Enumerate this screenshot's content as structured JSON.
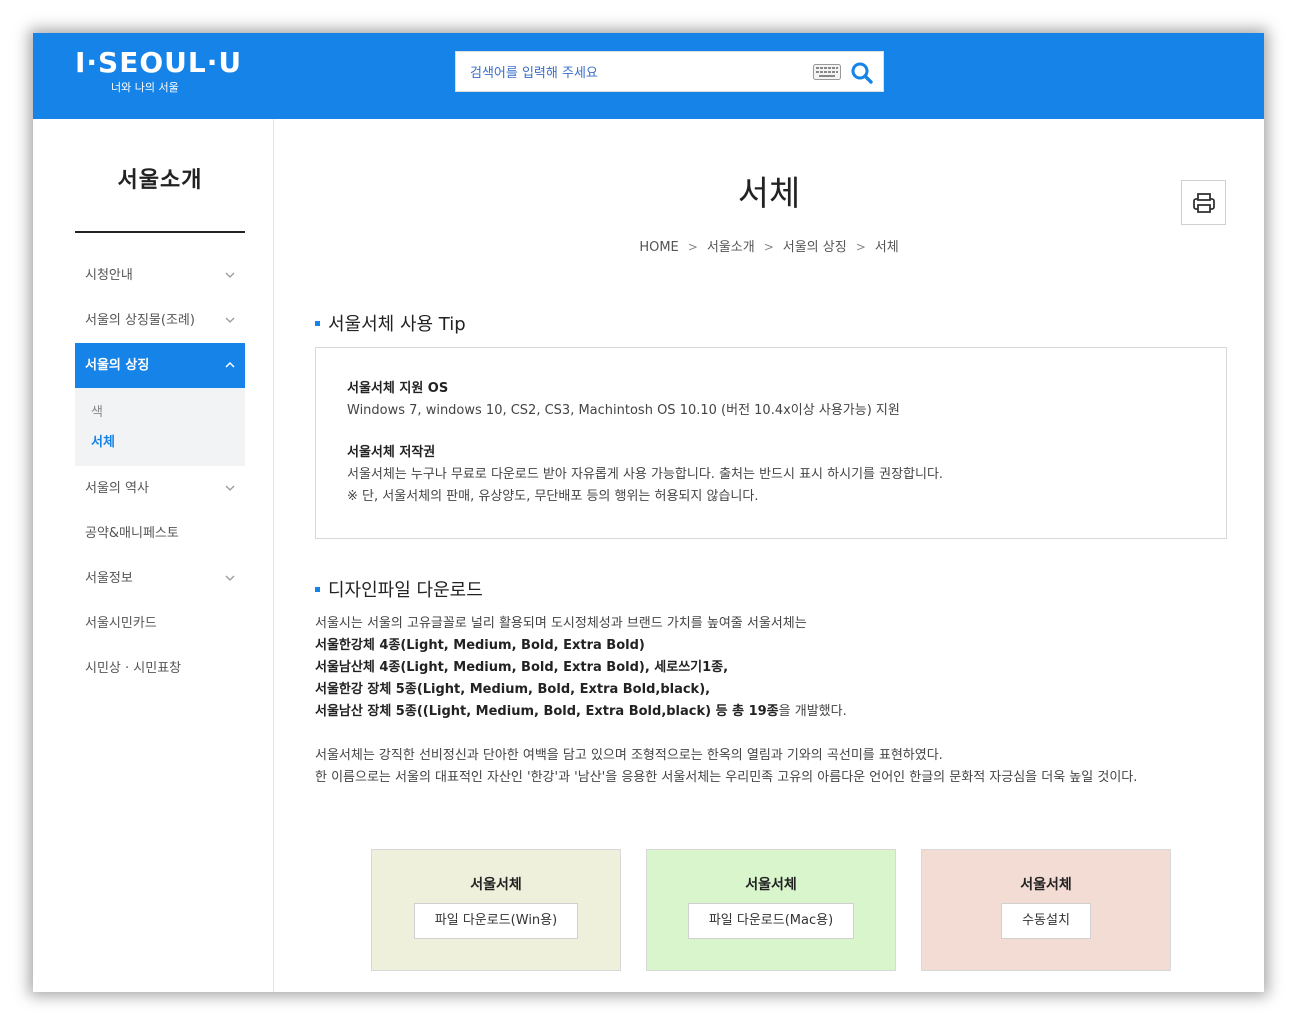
{
  "header": {
    "logo_text": "I·SEOUL·U",
    "logo_sub": "너와 나의 서울",
    "search_placeholder": "검색어를 입력해 주세요"
  },
  "sidebar": {
    "title": "서울소개",
    "items": [
      {
        "label": "시청안내",
        "has_chevron": true
      },
      {
        "label": "서울의 상징물(조례)",
        "has_chevron": true
      },
      {
        "label": "서울의 상징",
        "has_chevron": true,
        "active": true
      },
      {
        "label": "서울의 역사",
        "has_chevron": true
      },
      {
        "label": "공약&매니페스토",
        "has_chevron": false
      },
      {
        "label": "서울정보",
        "has_chevron": true
      },
      {
        "label": "서울시민카드",
        "has_chevron": false
      },
      {
        "label": "시민상 · 시민표창",
        "has_chevron": false
      }
    ],
    "subitems": [
      {
        "label": "색",
        "selected": false
      },
      {
        "label": "서체",
        "selected": true
      }
    ]
  },
  "main": {
    "page_title": "서체",
    "breadcrumb": [
      "HOME",
      "서울소개",
      "서울의 상징",
      "서체"
    ],
    "section1_title": "서울서체 사용 Tip",
    "tip": {
      "os_heading": "서울서체 지원 OS",
      "os_text": "Windows 7, windows 10, CS2, CS3, Machintosh OS 10.10 (버전 10.4x이상 사용가능) 지원",
      "copyright_heading": "서울서체 저작권",
      "copyright_text1": "서울서체는 누구나 무료로 다운로드 받아 자유롭게 사용 가능합니다. 출처는 반드시 표시 하시기를 권장합니다.",
      "copyright_text2": "※ 단, 서울서체의 판매, 유상양도, 무단배포 등의 행위는 허용되지 않습니다."
    },
    "section2_title": "디자인파일 다운로드",
    "intro": "서울시는 서울의 고유글꼴로 널리 활용되며 도시정체성과 브랜드 가치를 높여줄 서울서체는",
    "font_lines": [
      "서울한강체 4종(Light, Medium, Bold, Extra Bold)",
      "서울남산체 4종(Light, Medium, Bold, Extra Bold), 세로쓰기1종,",
      "서울한강 장체 5종(Light, Medium, Bold, Extra Bold,black),",
      "서울남산 장체 5종((Light, Medium, Bold, Extra Bold,black) 등 총 19종"
    ],
    "font_lines_tail": "을 개발했다.",
    "desc1": "서울서체는 강직한 선비정신과 단아한 여백을 담고 있으며 조형적으로는 한옥의 열림과 기와의 곡선미를 표현하였다.",
    "desc2": "한 이름으로는 서울의 대표적인 자산인 '한강'과 '남산'을 응용한 서울서체는 우리민족 고유의 아름다운 언어인 한글의 문화적 자긍심을 더욱 높일 것이다.",
    "downloads": [
      {
        "label": "서울서체",
        "button": "파일 다운로드(Win용)",
        "bg": "#eef0dc"
      },
      {
        "label": "서울서체",
        "button": "파일 다운로드(Mac용)",
        "bg": "#d9f5cc"
      },
      {
        "label": "서울서체",
        "button": "수동설치",
        "bg": "#f2dcd4"
      }
    ]
  },
  "colors": {
    "brand": "#1683e8"
  }
}
